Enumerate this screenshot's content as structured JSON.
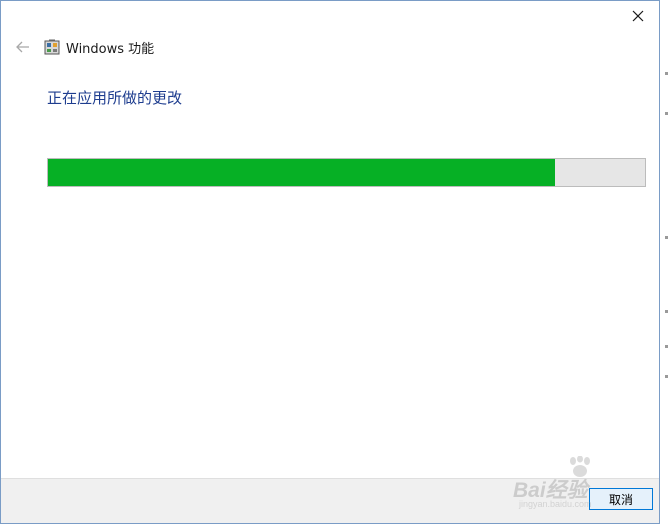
{
  "window": {
    "title": "Windows 功能"
  },
  "main": {
    "heading": "正在应用所做的更改"
  },
  "progress": {
    "fraction": 0.85,
    "fill_color": "#06b025",
    "track_color": "#e6e6e6"
  },
  "footer": {
    "cancel_label": "取消"
  },
  "watermark": {
    "text": "Bai经验",
    "sub": "jingyan.baidu.com"
  },
  "colors": {
    "heading": "#1e3d8f",
    "accent": "#0078d7"
  },
  "icons": {
    "close": "close-icon",
    "back": "back-arrow-icon",
    "app": "windows-features-icon"
  }
}
